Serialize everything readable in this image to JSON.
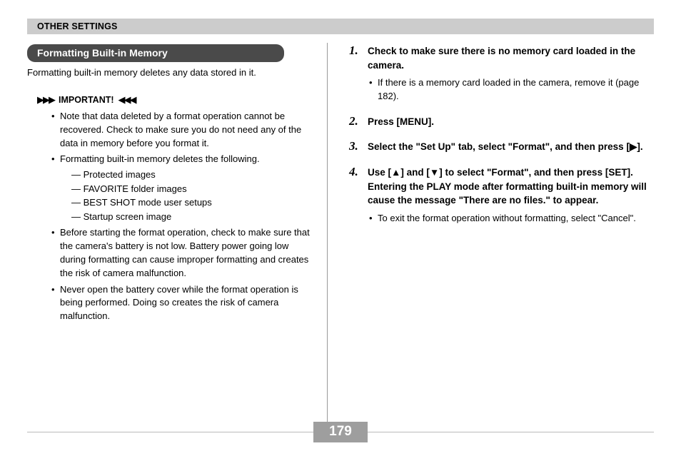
{
  "header": {
    "breadcrumb": "OTHER SETTINGS"
  },
  "left": {
    "section_title": "Formatting Built-in Memory",
    "intro": "Formatting built-in memory deletes any data stored in it.",
    "important_label": "IMPORTANT!",
    "notes": {
      "n1": "Note that data deleted by a format operation cannot be recovered. Check to make sure you do not need any of the data in memory before you format it.",
      "n2": "Formatting built-in memory deletes the following.",
      "n2_items": {
        "a": "Protected images",
        "b": "FAVORITE folder images",
        "c": "BEST SHOT mode user setups",
        "d": "Startup screen image"
      },
      "n3": "Before starting the format operation, check to make sure that the camera's battery is not low. Battery power going low during formatting can cause improper formatting and creates the risk of camera malfunction.",
      "n4": "Never open the battery cover while the format operation is being performed. Doing so creates the risk of camera malfunction."
    }
  },
  "right": {
    "s1": {
      "num": "1.",
      "main": "Check to make sure there is no memory card loaded in the camera.",
      "sub": "If there is a memory card loaded in the camera, remove it (page 182)."
    },
    "s2": {
      "num": "2.",
      "main": "Press [MENU]."
    },
    "s3": {
      "num": "3.",
      "main": "Select the \"Set Up\" tab, select \"Format\", and then press [▶]."
    },
    "s4": {
      "num": "4.",
      "main": "Use [▲] and [▼] to select \"Format\", and then press [SET]. Entering the PLAY mode after formatting built-in memory will cause the message \"There are no files.\" to appear.",
      "sub": "To exit the format operation without formatting, select \"Cancel\"."
    }
  },
  "page_number": "179"
}
